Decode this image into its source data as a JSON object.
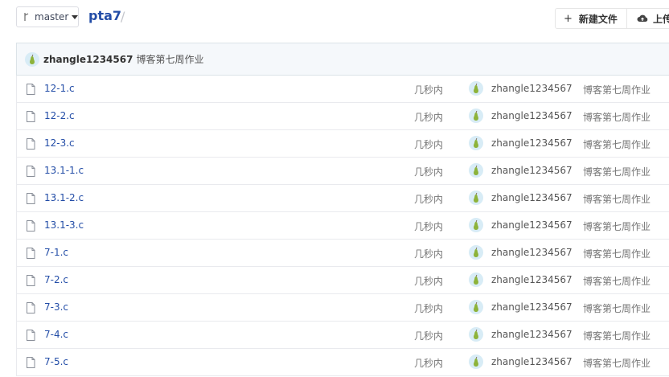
{
  "toolbar": {
    "branch": "master",
    "repo": "pta7",
    "separator": "/",
    "new_file_label": "新建文件",
    "new_file_plus": "+",
    "upload_label": "上传"
  },
  "commit": {
    "author": "zhangle1234567",
    "message": "博客第七周作业"
  },
  "files": [
    {
      "name": "12-1.c",
      "time": "几秒内",
      "author": "zhangle1234567",
      "message": "博客第七周作业"
    },
    {
      "name": "12-2.c",
      "time": "几秒内",
      "author": "zhangle1234567",
      "message": "博客第七周作业"
    },
    {
      "name": "12-3.c",
      "time": "几秒内",
      "author": "zhangle1234567",
      "message": "博客第七周作业"
    },
    {
      "name": "13.1-1.c",
      "time": "几秒内",
      "author": "zhangle1234567",
      "message": "博客第七周作业"
    },
    {
      "name": "13.1-2.c",
      "time": "几秒内",
      "author": "zhangle1234567",
      "message": "博客第七周作业"
    },
    {
      "name": "13.1-3.c",
      "time": "几秒内",
      "author": "zhangle1234567",
      "message": "博客第七周作业"
    },
    {
      "name": "7-1.c",
      "time": "几秒内",
      "author": "zhangle1234567",
      "message": "博客第七周作业"
    },
    {
      "name": "7-2.c",
      "time": "几秒内",
      "author": "zhangle1234567",
      "message": "博客第七周作业"
    },
    {
      "name": "7-3.c",
      "time": "几秒内",
      "author": "zhangle1234567",
      "message": "博客第七周作业"
    },
    {
      "name": "7-4.c",
      "time": "几秒内",
      "author": "zhangle1234567",
      "message": "博客第七周作业"
    },
    {
      "name": "7-5.c",
      "time": "几秒内",
      "author": "zhangle1234567",
      "message": "博客第七周作业"
    }
  ],
  "colors": {
    "link": "#234da7",
    "header_bg": "#f5f8fb",
    "avatar_bg": "#d8ecf6",
    "pear": "#8db33a"
  },
  "icons": {
    "branch": "branch-icon",
    "caret": "chevron-down-icon",
    "plus": "plus-icon",
    "upload": "cloud-upload-icon",
    "file": "file-icon",
    "avatar": "pear-avatar-icon"
  }
}
